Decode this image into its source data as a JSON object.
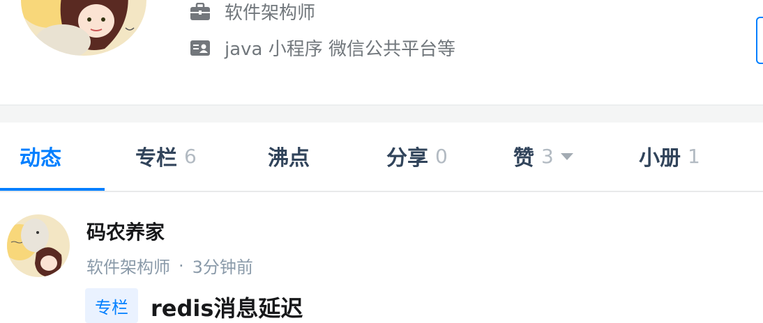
{
  "profile": {
    "job_title": "软件架构师",
    "intro": "java 小程序 微信公共平台等",
    "avatar_icon": "user-avatar-illustration"
  },
  "tabs": [
    {
      "label": "动态",
      "count": "",
      "active": true
    },
    {
      "label": "专栏",
      "count": "6",
      "active": false
    },
    {
      "label": "沸点",
      "count": "",
      "active": false
    },
    {
      "label": "分享",
      "count": "0",
      "active": false
    },
    {
      "label": "赞",
      "count": "3",
      "active": false,
      "icon": "caret-down-icon"
    },
    {
      "label": "小册",
      "count": "1",
      "active": false
    }
  ],
  "feed": {
    "author": "码农养家",
    "author_job": "软件架构师",
    "separator": "·",
    "time": "3分钟前",
    "tag": "专栏",
    "title": "redis消息延迟"
  },
  "colors": {
    "accent": "#007fff",
    "text_dark": "#17181a",
    "text_muted": "#8a9aa9",
    "tab_text": "#31445b"
  }
}
